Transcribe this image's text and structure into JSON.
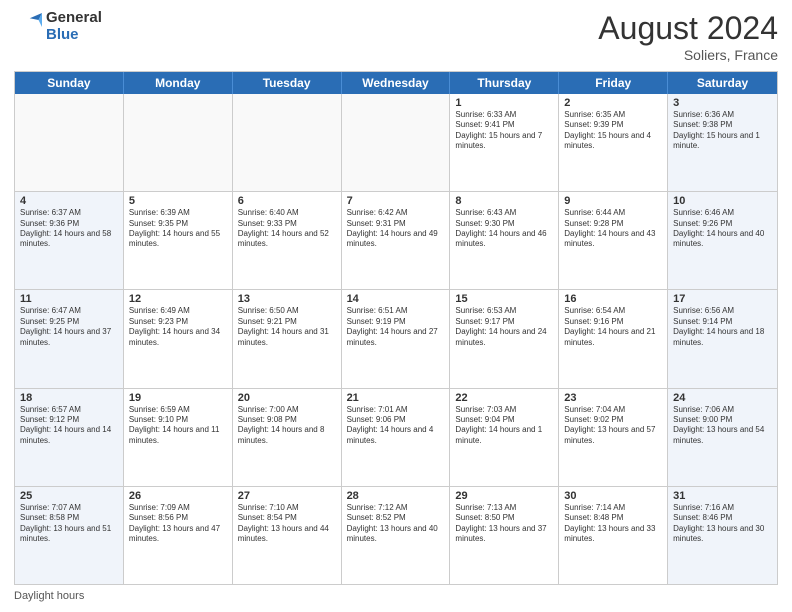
{
  "header": {
    "logo_general": "General",
    "logo_blue": "Blue",
    "month_year": "August 2024",
    "location": "Soliers, France"
  },
  "days_of_week": [
    "Sunday",
    "Monday",
    "Tuesday",
    "Wednesday",
    "Thursday",
    "Friday",
    "Saturday"
  ],
  "weeks": [
    [
      {
        "day": "",
        "info": ""
      },
      {
        "day": "",
        "info": ""
      },
      {
        "day": "",
        "info": ""
      },
      {
        "day": "",
        "info": ""
      },
      {
        "day": "1",
        "info": "Sunrise: 6:33 AM\nSunset: 9:41 PM\nDaylight: 15 hours and 7 minutes."
      },
      {
        "day": "2",
        "info": "Sunrise: 6:35 AM\nSunset: 9:39 PM\nDaylight: 15 hours and 4 minutes."
      },
      {
        "day": "3",
        "info": "Sunrise: 6:36 AM\nSunset: 9:38 PM\nDaylight: 15 hours and 1 minute."
      }
    ],
    [
      {
        "day": "4",
        "info": "Sunrise: 6:37 AM\nSunset: 9:36 PM\nDaylight: 14 hours and 58 minutes."
      },
      {
        "day": "5",
        "info": "Sunrise: 6:39 AM\nSunset: 9:35 PM\nDaylight: 14 hours and 55 minutes."
      },
      {
        "day": "6",
        "info": "Sunrise: 6:40 AM\nSunset: 9:33 PM\nDaylight: 14 hours and 52 minutes."
      },
      {
        "day": "7",
        "info": "Sunrise: 6:42 AM\nSunset: 9:31 PM\nDaylight: 14 hours and 49 minutes."
      },
      {
        "day": "8",
        "info": "Sunrise: 6:43 AM\nSunset: 9:30 PM\nDaylight: 14 hours and 46 minutes."
      },
      {
        "day": "9",
        "info": "Sunrise: 6:44 AM\nSunset: 9:28 PM\nDaylight: 14 hours and 43 minutes."
      },
      {
        "day": "10",
        "info": "Sunrise: 6:46 AM\nSunset: 9:26 PM\nDaylight: 14 hours and 40 minutes."
      }
    ],
    [
      {
        "day": "11",
        "info": "Sunrise: 6:47 AM\nSunset: 9:25 PM\nDaylight: 14 hours and 37 minutes."
      },
      {
        "day": "12",
        "info": "Sunrise: 6:49 AM\nSunset: 9:23 PM\nDaylight: 14 hours and 34 minutes."
      },
      {
        "day": "13",
        "info": "Sunrise: 6:50 AM\nSunset: 9:21 PM\nDaylight: 14 hours and 31 minutes."
      },
      {
        "day": "14",
        "info": "Sunrise: 6:51 AM\nSunset: 9:19 PM\nDaylight: 14 hours and 27 minutes."
      },
      {
        "day": "15",
        "info": "Sunrise: 6:53 AM\nSunset: 9:17 PM\nDaylight: 14 hours and 24 minutes."
      },
      {
        "day": "16",
        "info": "Sunrise: 6:54 AM\nSunset: 9:16 PM\nDaylight: 14 hours and 21 minutes."
      },
      {
        "day": "17",
        "info": "Sunrise: 6:56 AM\nSunset: 9:14 PM\nDaylight: 14 hours and 18 minutes."
      }
    ],
    [
      {
        "day": "18",
        "info": "Sunrise: 6:57 AM\nSunset: 9:12 PM\nDaylight: 14 hours and 14 minutes."
      },
      {
        "day": "19",
        "info": "Sunrise: 6:59 AM\nSunset: 9:10 PM\nDaylight: 14 hours and 11 minutes."
      },
      {
        "day": "20",
        "info": "Sunrise: 7:00 AM\nSunset: 9:08 PM\nDaylight: 14 hours and 8 minutes."
      },
      {
        "day": "21",
        "info": "Sunrise: 7:01 AM\nSunset: 9:06 PM\nDaylight: 14 hours and 4 minutes."
      },
      {
        "day": "22",
        "info": "Sunrise: 7:03 AM\nSunset: 9:04 PM\nDaylight: 14 hours and 1 minute."
      },
      {
        "day": "23",
        "info": "Sunrise: 7:04 AM\nSunset: 9:02 PM\nDaylight: 13 hours and 57 minutes."
      },
      {
        "day": "24",
        "info": "Sunrise: 7:06 AM\nSunset: 9:00 PM\nDaylight: 13 hours and 54 minutes."
      }
    ],
    [
      {
        "day": "25",
        "info": "Sunrise: 7:07 AM\nSunset: 8:58 PM\nDaylight: 13 hours and 51 minutes."
      },
      {
        "day": "26",
        "info": "Sunrise: 7:09 AM\nSunset: 8:56 PM\nDaylight: 13 hours and 47 minutes."
      },
      {
        "day": "27",
        "info": "Sunrise: 7:10 AM\nSunset: 8:54 PM\nDaylight: 13 hours and 44 minutes."
      },
      {
        "day": "28",
        "info": "Sunrise: 7:12 AM\nSunset: 8:52 PM\nDaylight: 13 hours and 40 minutes."
      },
      {
        "day": "29",
        "info": "Sunrise: 7:13 AM\nSunset: 8:50 PM\nDaylight: 13 hours and 37 minutes."
      },
      {
        "day": "30",
        "info": "Sunrise: 7:14 AM\nSunset: 8:48 PM\nDaylight: 13 hours and 33 minutes."
      },
      {
        "day": "31",
        "info": "Sunrise: 7:16 AM\nSunset: 8:46 PM\nDaylight: 13 hours and 30 minutes."
      }
    ]
  ],
  "footer": {
    "note": "Daylight hours"
  },
  "colors": {
    "header_bg": "#2a6db5",
    "header_text": "#ffffff",
    "weekend_bg": "#f0f4fa",
    "empty_bg": "#f9f9f9"
  }
}
